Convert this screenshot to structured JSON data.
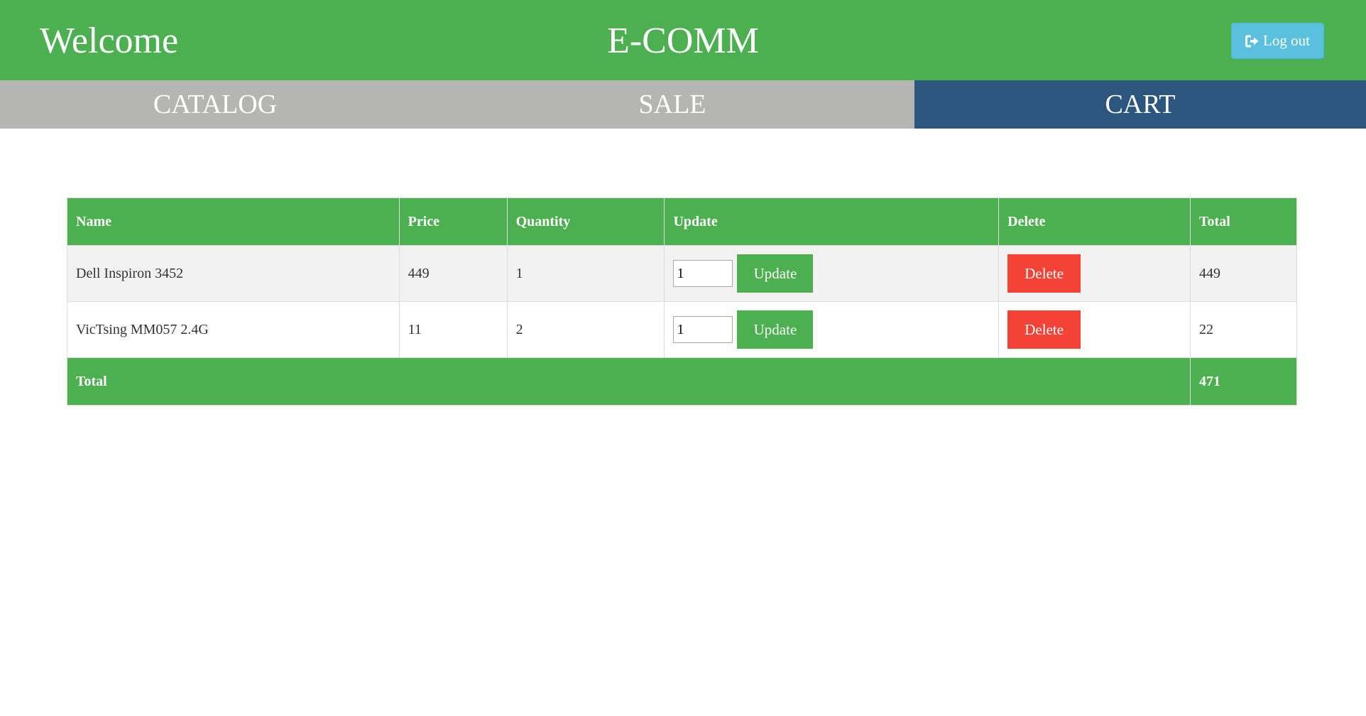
{
  "header": {
    "welcome": "Welcome",
    "brand": "E-COMM",
    "logout_label": "Log out",
    "logout_icon": "log-out-icon",
    "bg_color": "#4caf50"
  },
  "nav": {
    "catalog": "CATALOG",
    "sale": "SALE",
    "cart": "CART",
    "active": "CART",
    "active_color": "#2c567e",
    "inactive_color": "#b5b5b3"
  },
  "cart_table": {
    "columns": [
      "Name",
      "Price",
      "Quantity",
      "Update",
      "Delete",
      "Total"
    ],
    "rows": [
      {
        "name": "Dell Inspiron 3452",
        "price": "449",
        "quantity": "1",
        "input_value": "1",
        "update_label": "Update",
        "delete_label": "Delete",
        "total": "449"
      },
      {
        "name": "VicTsing MM057 2.4G",
        "price": "11",
        "quantity": "2",
        "input_value": "1",
        "update_label": "Update",
        "delete_label": "Delete",
        "total": "22"
      }
    ],
    "footer": {
      "label": "Total",
      "value": "471"
    },
    "update_color": "#4caf50",
    "delete_color": "#f44336"
  }
}
